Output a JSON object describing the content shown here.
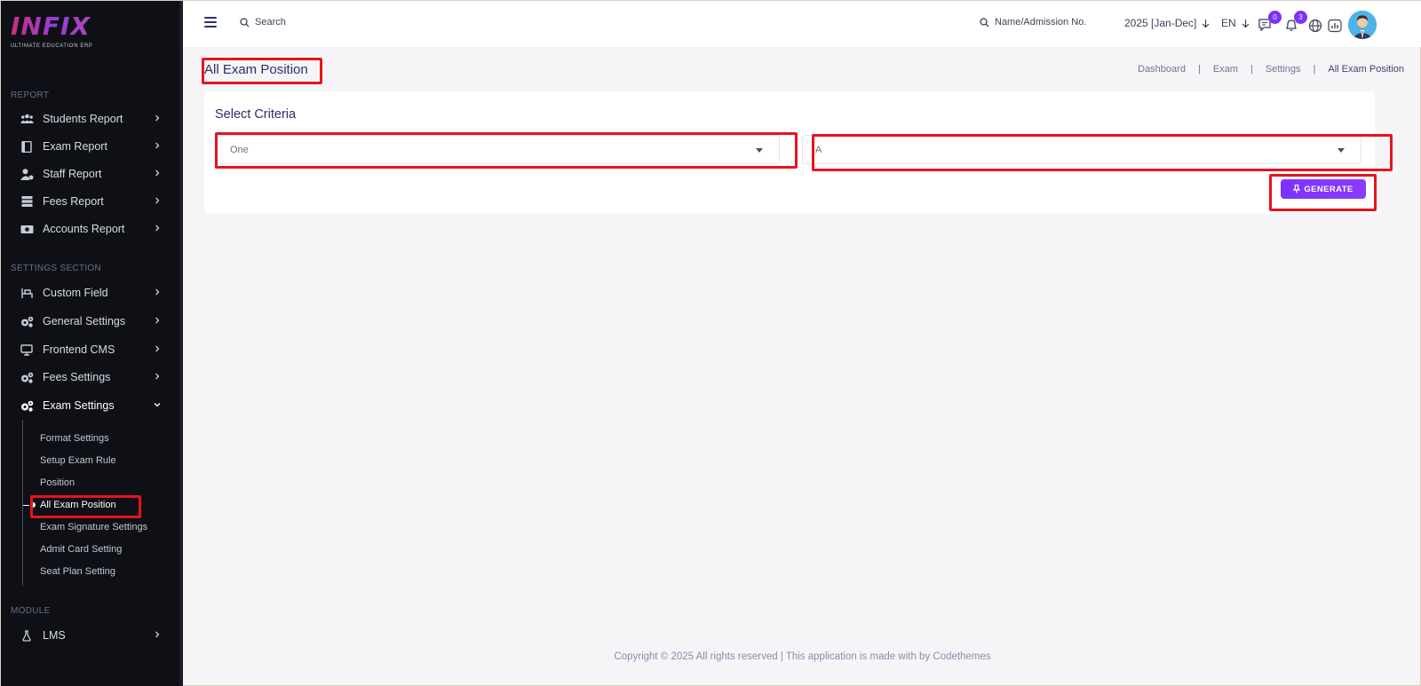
{
  "brand": {
    "logo_text": "INFIX",
    "tagline": "ULTIMATE EDUCATION ERP"
  },
  "sidebar": {
    "sections": [
      {
        "title": "REPORT"
      },
      {
        "title": "SETTINGS SECTION"
      },
      {
        "title": "MODULE"
      }
    ],
    "items": [
      {
        "label": "Students Report",
        "icon": "users-icon"
      },
      {
        "label": "Exam Report",
        "icon": "book-icon"
      },
      {
        "label": "Staff Report",
        "icon": "user-gear-icon"
      },
      {
        "label": "Fees Report",
        "icon": "server-icon"
      },
      {
        "label": "Accounts Report",
        "icon": "money-icon"
      },
      {
        "label": "Custom Field",
        "icon": "chair-icon"
      },
      {
        "label": "General Settings",
        "icon": "cogs-icon"
      },
      {
        "label": "Frontend CMS",
        "icon": "monitor-icon"
      },
      {
        "label": "Fees Settings",
        "icon": "cogs-icon"
      },
      {
        "label": "Exam Settings",
        "icon": "cogs-icon"
      },
      {
        "label": "LMS",
        "icon": "flask-icon"
      }
    ],
    "exam_settings_sub": [
      "Format Settings",
      "Setup Exam Rule",
      "Position",
      "All Exam Position",
      "Exam Signature Settings",
      "Admit Card Setting",
      "Seat Plan Setting"
    ]
  },
  "topbar": {
    "search_placeholder": "Search",
    "name_search_placeholder": "Name/Admission No.",
    "year": "2025 [Jan-Dec]",
    "lang": "EN",
    "messages_count": "0",
    "notifications_count": "3"
  },
  "page": {
    "title": "All Exam Position",
    "breadcrumb": [
      "Dashboard",
      "Exam",
      "Settings",
      "All Exam Position"
    ],
    "card_title": "Select Criteria",
    "class_select": "One",
    "section_select": "A",
    "generate_label": "GENERATE"
  },
  "footer": "Copyright © 2025 All rights reserved | This application is made with by Codethemes",
  "colors": {
    "accent": "#7c32ff",
    "sidebar_bg": "#0e1016",
    "highlight": "#e8131f"
  }
}
